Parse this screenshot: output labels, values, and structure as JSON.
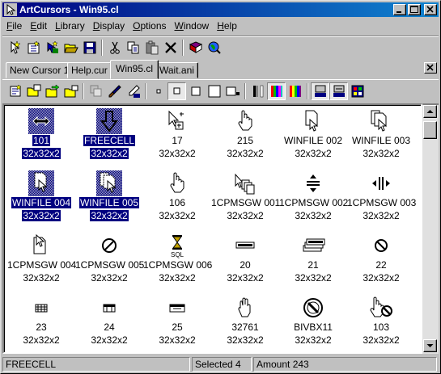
{
  "window": {
    "title": "ArtCursors - Win95.cl"
  },
  "menu": [
    {
      "label": "File",
      "u": "F",
      "rest": "ile"
    },
    {
      "label": "Edit",
      "u": "E",
      "rest": "dit"
    },
    {
      "label": "Library",
      "u": "L",
      "rest": "ibrary"
    },
    {
      "label": "Display",
      "u": "D",
      "rest": "isplay"
    },
    {
      "label": "Options",
      "u": "O",
      "rest": "ptions"
    },
    {
      "label": "Window",
      "u": "W",
      "rest": "indow"
    },
    {
      "label": "Help",
      "u": "H",
      "rest": "elp"
    }
  ],
  "tabs": [
    {
      "label": "New Cursor 1"
    },
    {
      "label": "Help.cur"
    },
    {
      "label": "Win95.cl"
    },
    {
      "label": "Wait.ani"
    }
  ],
  "active_tab": "Win95.cl",
  "items": [
    {
      "name": "101",
      "size": "32x32x2",
      "selected": true,
      "icon": "horizontal-resize-icon"
    },
    {
      "name": "FREECELL",
      "size": "32x32x2",
      "selected": true,
      "icon": "down-arrow-icon"
    },
    {
      "name": "17",
      "size": "32x32x2",
      "selected": false,
      "icon": "arrow-copy-icon"
    },
    {
      "name": "215",
      "size": "32x32x2",
      "selected": false,
      "icon": "hand-icon"
    },
    {
      "name": "WINFILE 002",
      "size": "32x32x2",
      "selected": false,
      "icon": "file-arrow-icon"
    },
    {
      "name": "WINFILE 003",
      "size": "32x32x2",
      "selected": false,
      "icon": "files-arrow-icon"
    },
    {
      "name": "WINFILE 004",
      "size": "32x32x2",
      "selected": true,
      "icon": "file-drag-icon"
    },
    {
      "name": "WINFILE 005",
      "size": "32x32x2",
      "selected": true,
      "icon": "files-drag-icon"
    },
    {
      "name": "106",
      "size": "32x32x2",
      "selected": false,
      "icon": "pointing-hand-icon"
    },
    {
      "name": "1CPMSGW 001",
      "size": "32x32x2",
      "selected": false,
      "icon": "pages-arrow-icon"
    },
    {
      "name": "1CPMSGW 002",
      "size": "32x32x2",
      "selected": false,
      "icon": "vertical-split-icon"
    },
    {
      "name": "1CPMSGW 003",
      "size": "32x32x2",
      "selected": false,
      "icon": "horizontal-split-icon"
    },
    {
      "name": "1CPMSGW 004",
      "size": "32x32x2",
      "selected": false,
      "icon": "page-arrow-icon"
    },
    {
      "name": "1CPMSGW 005",
      "size": "32x32x2",
      "selected": false,
      "icon": "no-entry-icon"
    },
    {
      "name": "1CPMSGW 006",
      "size": "32x32x2",
      "selected": false,
      "icon": "hourglass-sql-icon"
    },
    {
      "name": "20",
      "size": "32x32x2",
      "selected": false,
      "icon": "record-icon"
    },
    {
      "name": "21",
      "size": "32x32x2",
      "selected": false,
      "icon": "records-icon"
    },
    {
      "name": "22",
      "size": "32x32x2",
      "selected": false,
      "icon": "no-symbol-icon"
    },
    {
      "name": "23",
      "size": "32x32x2",
      "selected": false,
      "icon": "grid-table-icon"
    },
    {
      "name": "24",
      "size": "32x32x2",
      "selected": false,
      "icon": "table-icon"
    },
    {
      "name": "25",
      "size": "32x32x2",
      "selected": false,
      "icon": "table-bar-icon"
    },
    {
      "name": "32761",
      "size": "32x32x2",
      "selected": false,
      "icon": "grab-hand-icon"
    },
    {
      "name": "BIVBX11",
      "size": "32x32x2",
      "selected": false,
      "icon": "big-no-icon"
    },
    {
      "name": "103",
      "size": "32x32x2",
      "selected": false,
      "icon": "hand-no-icon"
    }
  ],
  "status": {
    "current": "FREECELL",
    "selected": "Selected 4",
    "amount": "Amount 243"
  }
}
